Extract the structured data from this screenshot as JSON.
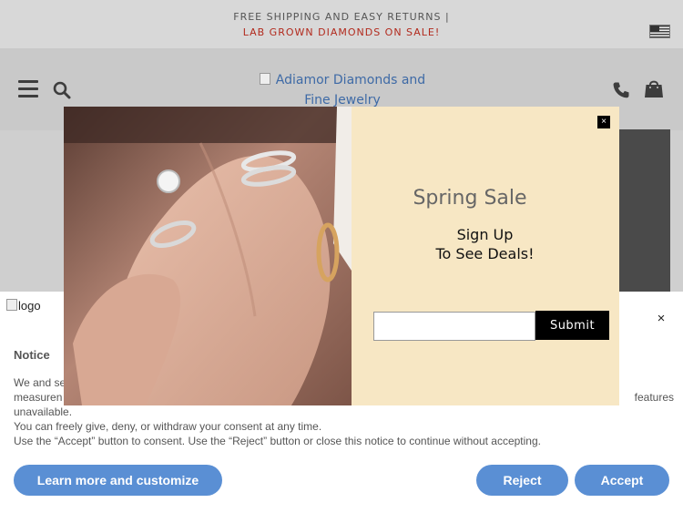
{
  "promo": {
    "line1": "FREE SHIPPING AND EASY RETURNS |",
    "line2": "LAB GROWN DIAMONDS ON SALE!"
  },
  "header": {
    "logo_line1": "Adiamor Diamonds and",
    "logo_line2": "Fine Jewelry"
  },
  "popup": {
    "close_label": "×",
    "title": "Spring Sale",
    "subtitle_line1": "Sign Up",
    "subtitle_line2": "To See Deals!",
    "email_value": "",
    "submit_label": "Submit"
  },
  "cookie": {
    "logo_alt": "logo",
    "close_label": "×",
    "title": "Notice",
    "text_line1_left": "We and se",
    "text_line2_left": "measuren",
    "text_line2_right": "features",
    "text_line3": "unavailable.",
    "text_line4": "You can freely give, deny, or withdraw your consent at any time.",
    "text_line5": "Use the “Accept” button to consent. Use the “Reject” button or close this notice to continue without accepting.",
    "learn_more_label": "Learn more and customize",
    "reject_label": "Reject",
    "accept_label": "Accept"
  },
  "colors": {
    "accent_button": "#5a8fd4",
    "promo_red": "#b22a1d",
    "popup_bg": "#f7e7c4"
  }
}
